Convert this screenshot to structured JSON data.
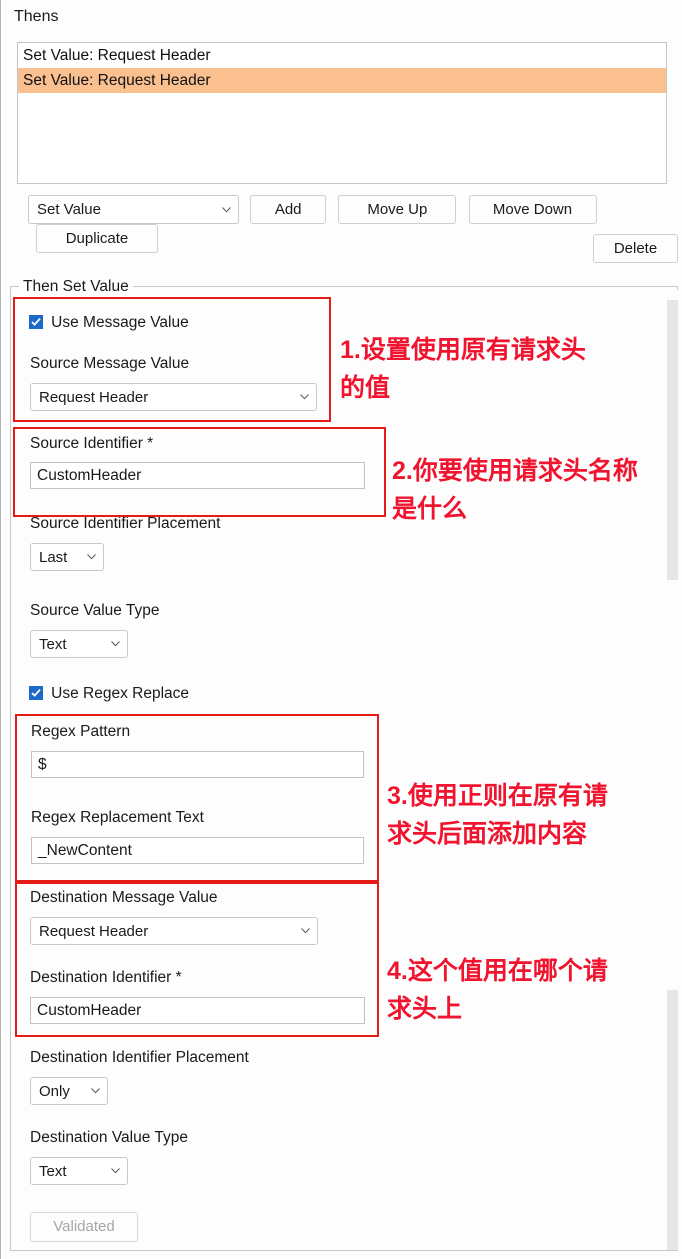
{
  "window": {
    "thens_label": "Thens"
  },
  "thens_list": {
    "items": [
      {
        "label": "Set Value: Request Header",
        "selected": false
      },
      {
        "label": "Set Value: Request Header",
        "selected": true
      }
    ]
  },
  "toolbar": {
    "action_select_value": "Set Value",
    "add_label": "Add",
    "move_up_label": "Move Up",
    "move_down_label": "Move Down",
    "duplicate_label": "Duplicate",
    "delete_label": "Delete"
  },
  "group": {
    "legend": "Then Set Value"
  },
  "form": {
    "use_message_value_label": "Use Message Value",
    "use_message_value_checked": true,
    "source_message_value_label": "Source Message Value",
    "source_message_value": "Request Header",
    "source_identifier_label": "Source Identifier *",
    "source_identifier_value": "CustomHeader",
    "source_identifier_placement_label": "Source Identifier Placement",
    "source_identifier_placement_value": "Last",
    "source_value_type_label": "Source Value Type",
    "source_value_type_value": "Text",
    "use_regex_replace_label": "Use Regex Replace",
    "use_regex_replace_checked": true,
    "regex_pattern_label": "Regex Pattern",
    "regex_pattern_value": "$",
    "regex_replacement_label": "Regex Replacement Text",
    "regex_replacement_value": "_NewContent",
    "destination_message_value_label": "Destination Message Value",
    "destination_message_value": "Request Header",
    "destination_identifier_label": "Destination Identifier *",
    "destination_identifier_value": "CustomHeader",
    "destination_identifier_placement_label": "Destination Identifier Placement",
    "destination_identifier_placement_value": "Only",
    "destination_value_type_label": "Destination Value Type",
    "destination_value_type_value": "Text",
    "validated_label": "Validated"
  },
  "annotations": [
    {
      "id": 1,
      "text": "1.设置使用原有请求头\n的值"
    },
    {
      "id": 2,
      "text": "2.你要使用请求头名称\n是什么"
    },
    {
      "id": 3,
      "text": "3.使用正则在原有请\n求头后面添加内容"
    },
    {
      "id": 4,
      "text": "4.这个值用在哪个请\n求头上"
    }
  ],
  "colors": {
    "selection_highlight": "#fac090",
    "annotation_red": "#f0142f",
    "annotation_box_red": "#e41b17",
    "checkbox_blue": "#1b6ac9"
  }
}
